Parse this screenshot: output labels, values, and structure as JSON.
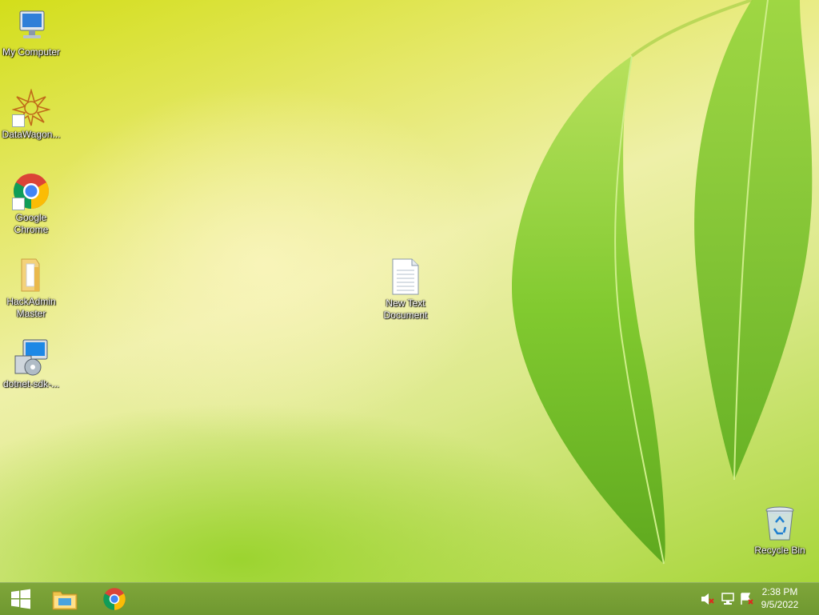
{
  "desktop": {
    "icons": [
      {
        "label": "My Computer",
        "icon": "computer-icon"
      },
      {
        "label": "DataWagon...",
        "icon": "datawagon-icon"
      },
      {
        "label": "Google Chrome",
        "icon": "chrome-icon"
      },
      {
        "label": "HackAdmin Master",
        "icon": "folder-icon"
      },
      {
        "label": "dotnet-sdk-...",
        "icon": "installer-icon"
      },
      {
        "label": "New Text Document",
        "icon": "text-document-icon"
      },
      {
        "label": "Recycle Bin",
        "icon": "recycle-bin-icon"
      }
    ]
  },
  "taskbar": {
    "start_icon": "windows-logo-icon",
    "pinned": [
      {
        "icon": "file-explorer-icon"
      },
      {
        "icon": "chrome-icon"
      }
    ],
    "tray": {
      "icons": [
        "speaker-muted-icon",
        "network-icon",
        "action-center-icon"
      ],
      "time": "2:38 PM",
      "date": "9/5/2022"
    }
  },
  "colors": {
    "wallpaper_yellow": "#e5e86a",
    "leaf_green": "#7cc82a",
    "taskbar": "#6f9830"
  }
}
